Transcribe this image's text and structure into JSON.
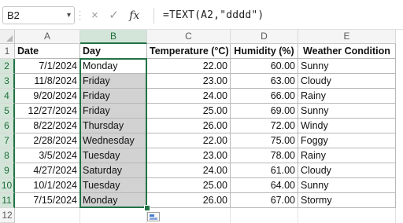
{
  "formula_bar": {
    "name_box": "B2",
    "name_dropdown_icon": "chevron-down-icon",
    "cancel_icon": "×",
    "enter_icon": "✓",
    "fx_label": "fx",
    "formula": "=TEXT(A2,\"dddd\")"
  },
  "columns": [
    "A",
    "B",
    "C",
    "D",
    "E"
  ],
  "selected_column": "B",
  "row_numbers": [
    "1",
    "2",
    "3",
    "4",
    "5",
    "6",
    "7",
    "8",
    "9",
    "10",
    "11",
    "12"
  ],
  "headers": {
    "date": "Date",
    "day": "Day",
    "temperature": "Temperature (°C)",
    "humidity": "Humidity (%)",
    "weather": "Weather Condition"
  },
  "rows": [
    {
      "date": "7/1/2024",
      "day": "Monday",
      "temp": "22.00",
      "humidity": "60.00",
      "weather": "Sunny"
    },
    {
      "date": "11/8/2024",
      "day": "Friday",
      "temp": "23.00",
      "humidity": "63.00",
      "weather": "Cloudy"
    },
    {
      "date": "9/20/2024",
      "day": "Friday",
      "temp": "24.00",
      "humidity": "66.00",
      "weather": "Rainy"
    },
    {
      "date": "12/27/2024",
      "day": "Friday",
      "temp": "25.00",
      "humidity": "69.00",
      "weather": "Sunny"
    },
    {
      "date": "8/22/2024",
      "day": "Thursday",
      "temp": "26.00",
      "humidity": "72.00",
      "weather": "Windy"
    },
    {
      "date": "2/28/2024",
      "day": "Wednesday",
      "temp": "22.00",
      "humidity": "75.00",
      "weather": "Foggy"
    },
    {
      "date": "3/5/2024",
      "day": "Tuesday",
      "temp": "23.00",
      "humidity": "78.00",
      "weather": "Rainy"
    },
    {
      "date": "4/27/2024",
      "day": "Saturday",
      "temp": "24.00",
      "humidity": "61.00",
      "weather": "Cloudy"
    },
    {
      "date": "10/1/2024",
      "day": "Tuesday",
      "temp": "25.00",
      "humidity": "64.00",
      "weather": "Sunny"
    },
    {
      "date": "7/15/2024",
      "day": "Monday",
      "temp": "26.00",
      "humidity": "67.00",
      "weather": "Stormy"
    }
  ],
  "colors": {
    "selection_border": "#217346",
    "selection_fill": "#d2d2d2",
    "header_highlight": "#d3e5d8"
  }
}
